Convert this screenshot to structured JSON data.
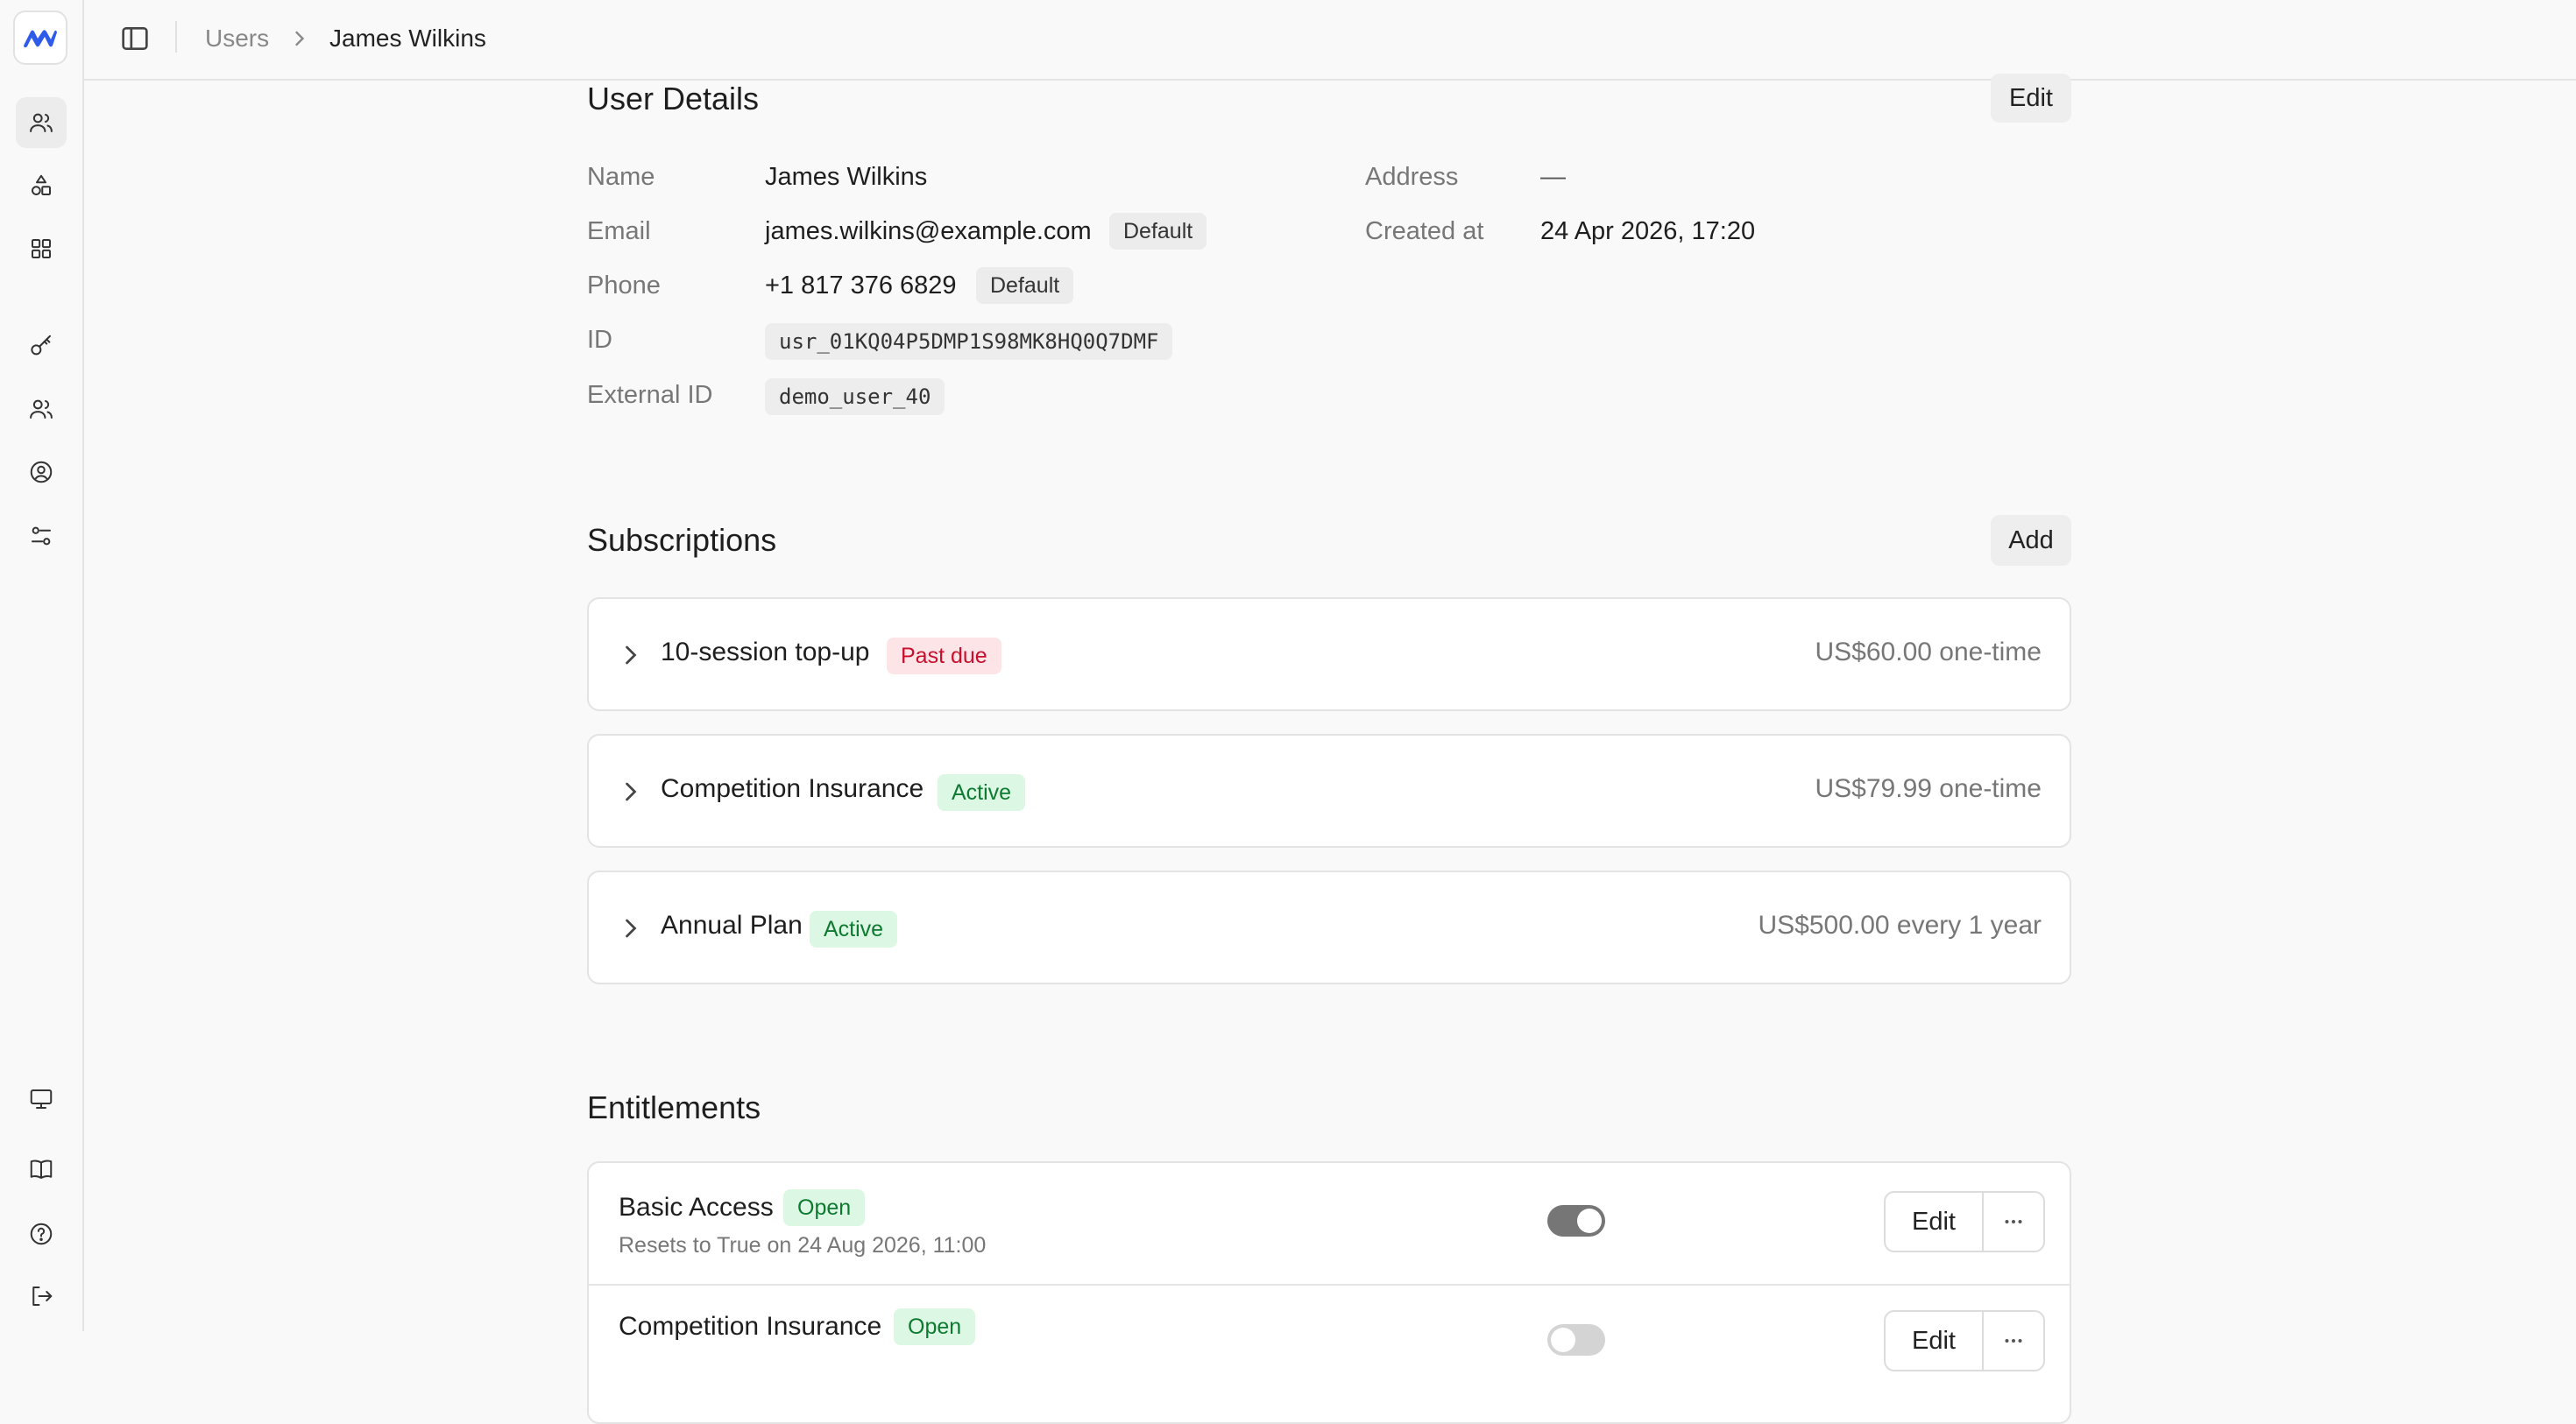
{
  "breadcrumb": {
    "parent": "Users",
    "current": "James Wilkins"
  },
  "sidebar": {
    "top_items": [
      {
        "icon": "users-icon",
        "active": true
      },
      {
        "icon": "shapes-icon",
        "active": false
      },
      {
        "icon": "grid-icon",
        "active": false
      },
      {
        "icon": "key-icon",
        "active": false
      },
      {
        "icon": "team-icon",
        "active": false
      },
      {
        "icon": "user-circle-icon",
        "active": false
      },
      {
        "icon": "sliders-icon",
        "active": false
      }
    ],
    "bottom_items": [
      {
        "icon": "monitor-icon"
      },
      {
        "icon": "book-icon"
      },
      {
        "icon": "help-circle-icon"
      },
      {
        "icon": "logout-icon"
      }
    ],
    "brand_color": "#2f5bea"
  },
  "user_details": {
    "title": "User Details",
    "edit_label": "Edit",
    "name_label": "Name",
    "name": "James Wilkins",
    "email_label": "Email",
    "email": "james.wilkins@example.com",
    "email_badge": "Default",
    "phone_label": "Phone",
    "phone": "+1 817 376 6829",
    "phone_badge": "Default",
    "id_label": "ID",
    "id": "usr_01KQ04P5DMP1S98MK8HQ0Q7DMF",
    "external_id_label": "External ID",
    "external_id": "demo_user_40",
    "address_label": "Address",
    "address": "—",
    "created_label": "Created at",
    "created": "24 Apr 2026, 17:20"
  },
  "subscriptions": {
    "title": "Subscriptions",
    "add_label": "Add",
    "items": [
      {
        "name": "10-session top-up",
        "status": "Past due",
        "status_color": "#c8102e",
        "price": "US$60.00 one-time"
      },
      {
        "name": "Competition Insurance",
        "status": "Active",
        "status_color": "#0e7a31",
        "price": "US$79.99 one-time"
      },
      {
        "name": "Annual Plan",
        "status": "Active",
        "status_color": "#0e7a31",
        "price": "US$500.00 every 1 year"
      }
    ]
  },
  "entitlements": {
    "title": "Entitlements",
    "items": [
      {
        "name": "Basic Access",
        "status": "Open",
        "subtitle": "Resets to True on 24 Aug 2026, 11:00",
        "enabled": true,
        "edit_label": "Edit"
      },
      {
        "name": "Competition Insurance",
        "status": "Open",
        "subtitle": "",
        "enabled": false,
        "edit_label": "Edit"
      }
    ]
  }
}
